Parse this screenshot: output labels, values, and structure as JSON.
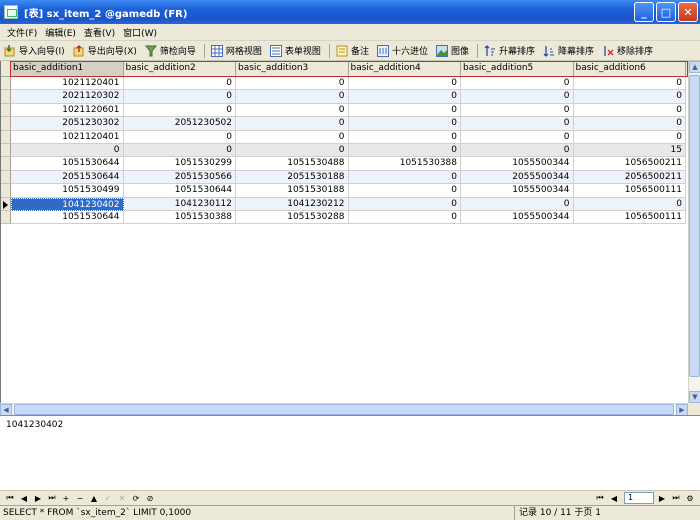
{
  "window": {
    "title": "[表] sx_item_2 @gamedb (FR)"
  },
  "menu": [
    "文件(F)",
    "编辑(E)",
    "查看(V)",
    "窗口(W)"
  ],
  "toolbar": {
    "import": "导入向导(I)",
    "export": "导出向导(X)",
    "filter": "筛检向导",
    "grid_view": "网格视图",
    "form_view": "表单视图",
    "memo": "备注",
    "hex": "十六进位",
    "image": "图像",
    "sort_asc": "升幕排序",
    "sort_desc": "降幕排序",
    "remove_sort": "移除排序"
  },
  "grid": {
    "columns": [
      "basic_addition1",
      "basic_addition2",
      "basic_addition3",
      "basic_addition4",
      "basic_addition5",
      "basic_addition6"
    ],
    "rows": [
      [
        "1021120401",
        "0",
        "0",
        "0",
        "0",
        "0"
      ],
      [
        "2021120302",
        "0",
        "0",
        "0",
        "0",
        "0"
      ],
      [
        "1021120601",
        "0",
        "0",
        "0",
        "0",
        "0"
      ],
      [
        "2051230302",
        "2051230502",
        "0",
        "0",
        "0",
        "0"
      ],
      [
        "1021120401",
        "0",
        "0",
        "0",
        "0",
        "0"
      ],
      [
        "0",
        "0",
        "0",
        "0",
        "0",
        "15"
      ],
      [
        "1051530644",
        "1051530299",
        "1051530488",
        "1051530388",
        "1055500344",
        "1056500211"
      ],
      [
        "2051530644",
        "2051530566",
        "2051530188",
        "0",
        "2055500344",
        "2056500211"
      ],
      [
        "1051530499",
        "1051530644",
        "1051530188",
        "0",
        "1055500344",
        "1056500111"
      ],
      [
        "1041230402",
        "1041230112",
        "1041230212",
        "0",
        "0",
        "0"
      ],
      [
        "1051530644",
        "1051530388",
        "1051530288",
        "0",
        "1055500344",
        "1056500111"
      ]
    ],
    "current_row": 9
  },
  "detail": {
    "value": "1041230402"
  },
  "navigator": {
    "first": "⏮",
    "prev": "◀",
    "next": "▶",
    "last": "⏭",
    "add": "+",
    "delete": "−",
    "up": "▲",
    "confirm": "✓",
    "cancel": "✕",
    "refresh": "⟳",
    "stop": "⊘",
    "page": "1"
  },
  "status": {
    "sql": "SELECT * FROM `sx_item_2` LIMIT 0,1000",
    "record": "记录 10 / 11 于页 1"
  },
  "colors": {
    "selected_cell": "#316ac5",
    "header_outline": "#c03030",
    "titlebar": "#1c5fd6"
  }
}
